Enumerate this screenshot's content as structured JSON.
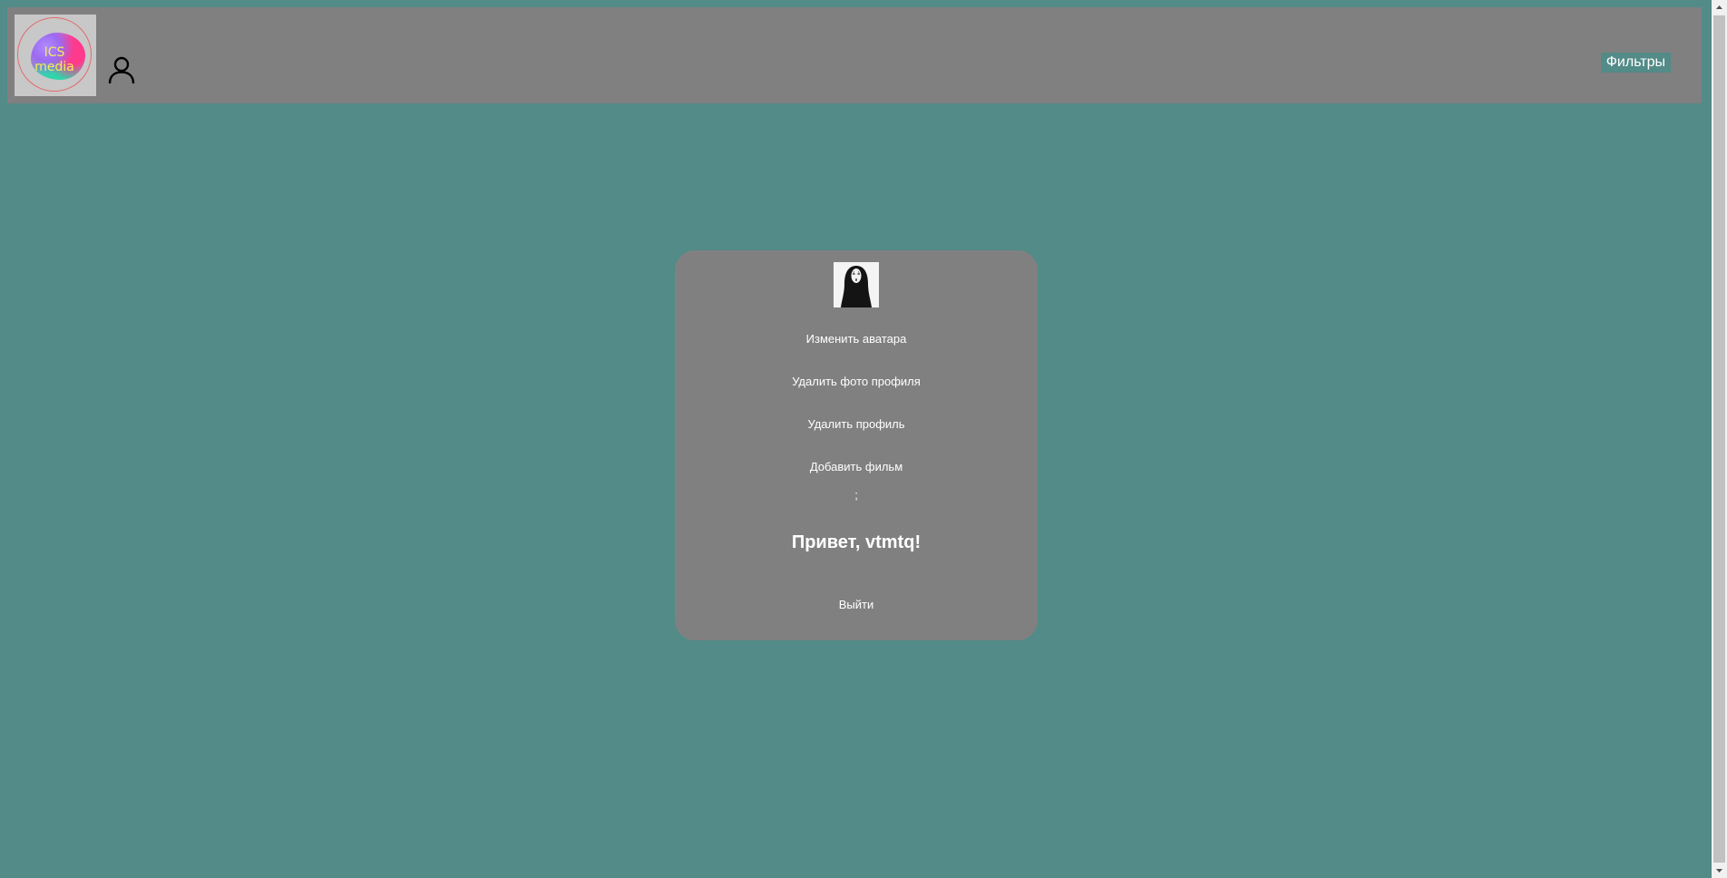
{
  "header": {
    "logo": {
      "line1": "ICS",
      "line2": "media"
    },
    "profile_icon": "user-icon",
    "filters_label": "Фильтры"
  },
  "profile_card": {
    "avatar_icon": "no-face-avatar",
    "change_avatar": "Изменить аватара",
    "delete_photo": "Удалить фото профиля",
    "delete_profile": "Удалить профиль",
    "add_film": "Добавить фильм",
    "separator": ";",
    "greeting": "Привет, vtmtq!",
    "logout": "Выйти"
  },
  "colors": {
    "page_bg": "#528b87",
    "panel_bg": "#808080",
    "text": "#ffffff"
  }
}
